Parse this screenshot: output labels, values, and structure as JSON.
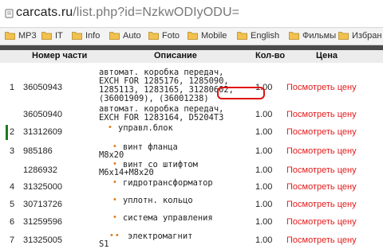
{
  "address_bar": {
    "domain": "carcats.ru",
    "path": "/list.php?id=NzkwODIyODU="
  },
  "bookmarks": [
    {
      "label": "MP3",
      "icon": "folder-icon"
    },
    {
      "label": "IT",
      "icon": "folder-icon"
    },
    {
      "label": "Info",
      "icon": "folder-icon"
    },
    {
      "label": "Auto",
      "icon": "folder-icon"
    },
    {
      "label": "Foto",
      "icon": "folder-icon"
    },
    {
      "label": "Mobile",
      "icon": "folder-icon"
    },
    {
      "label": "English",
      "icon": "folder-icon"
    },
    {
      "label": "Фильмы",
      "icon": "folder-icon"
    },
    {
      "label": "Избран",
      "icon": "folder-icon"
    }
  ],
  "table": {
    "headers": {
      "part": "Номер части",
      "description": "Описание",
      "qty": "Кол-во",
      "price": "Цена"
    },
    "rows": [
      {
        "num": "1",
        "part": "36050943",
        "desc_lines": [
          "автомат. коробка передач,",
          "EXCH FOR 1285176, 1285090,",
          "1285113, 1283165, 31280602,",
          "(36001909), (36001238)"
        ],
        "qty": "1.00",
        "price": "Посмотреть цену"
      },
      {
        "num": "",
        "part": "36050940",
        "desc_lines": [
          "автомат. коробка передач,",
          "EXCH FOR 1283164, D5204T3"
        ],
        "qty": "1.00",
        "price": "Посмотреть цену"
      },
      {
        "num": "2",
        "part": "31312609",
        "desc_lines": [
          "управл.блок"
        ],
        "qty": "1.00",
        "price": "Посмотреть цену"
      },
      {
        "num": "3",
        "part": "985186",
        "desc_lines": [
          "винт фланца",
          "M8x20"
        ],
        "qty": "1.00",
        "price": "Посмотреть цену"
      },
      {
        "num": "",
        "part": "1286932",
        "desc_lines": [
          "винт со штифтом",
          "M6x14+M8x20"
        ],
        "qty": "1.00",
        "price": "Посмотреть цену"
      },
      {
        "num": "4",
        "part": "31325000",
        "desc_lines": [
          "гидротрансформатор"
        ],
        "qty": "1.00",
        "price": "Посмотреть цену"
      },
      {
        "num": "5",
        "part": "30713726",
        "desc_lines": [
          "уплотн. кольцо"
        ],
        "qty": "1.00",
        "price": "Посмотреть цену"
      },
      {
        "num": "6",
        "part": "31259596",
        "desc_lines": [
          "система управления"
        ],
        "qty": "1.00",
        "price": "Посмотреть цену"
      },
      {
        "num": "7",
        "part": "31325005",
        "desc_lines": [
          "электромагнит",
          "S1"
        ],
        "qty": "1.00",
        "price": "Посмотреть цену"
      }
    ]
  },
  "colors": {
    "price_link": "#e31b1b",
    "bullet": "#e07b21",
    "highlight": "#e01010",
    "folder": "#f2c14e"
  }
}
